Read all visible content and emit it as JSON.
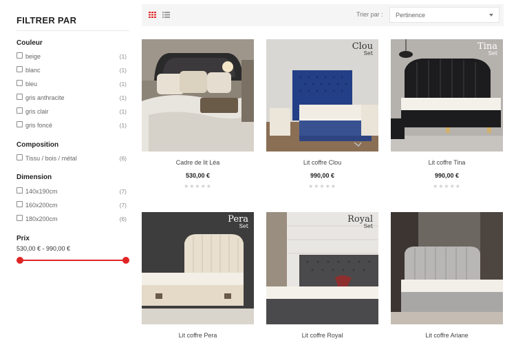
{
  "filters": {
    "title": "FILTRER PAR",
    "groups": [
      {
        "title": "Couleur",
        "options": [
          {
            "label": "beige",
            "count": "(1)"
          },
          {
            "label": "blanc",
            "count": "(1)"
          },
          {
            "label": "bleu",
            "count": "(1)"
          },
          {
            "label": "gris anthracite",
            "count": "(1)"
          },
          {
            "label": "gris clair",
            "count": "(1)"
          },
          {
            "label": "gris foncé",
            "count": "(1)"
          }
        ]
      },
      {
        "title": "Composition",
        "options": [
          {
            "label": "Tissu / bois / métal",
            "count": "(6)"
          }
        ]
      },
      {
        "title": "Dimension",
        "options": [
          {
            "label": "140x190cm",
            "count": "(7)"
          },
          {
            "label": "160x200cm",
            "count": "(7)"
          },
          {
            "label": "180x200cm",
            "count": "(6)"
          }
        ]
      }
    ],
    "price": {
      "title": "Prix",
      "range_text": "530,00 € - 990,00 €",
      "min": 530,
      "max": 990
    }
  },
  "toolbar": {
    "sort_label": "Trier par :",
    "sort_value": "Pertinence"
  },
  "products": [
    {
      "name": "Cadre de lit Léa",
      "price": "530,00 €",
      "stars": "★★★★★",
      "badge_name": "",
      "badge_sub": ""
    },
    {
      "name": "Lit coffre Clou",
      "price": "990,00 €",
      "stars": "★★★★★",
      "badge_name": "Clou",
      "badge_sub": "Set"
    },
    {
      "name": "Lit coffre Tina",
      "price": "990,00 €",
      "stars": "★★★★★",
      "badge_name": "Tina",
      "badge_sub": "Set"
    },
    {
      "name": "Lit coffre Pera",
      "price": "",
      "stars": "",
      "badge_name": "Pera",
      "badge_sub": "Set"
    },
    {
      "name": "Lit coffre Royal",
      "price": "",
      "stars": "",
      "badge_name": "Royal",
      "badge_sub": "Set"
    },
    {
      "name": "Lit coffre Ariane",
      "price": "",
      "stars": "",
      "badge_name": "",
      "badge_sub": ""
    }
  ],
  "colors": {
    "accent": "#e02424",
    "grid_icon_active": "#e02424",
    "list_icon": "#999999"
  },
  "icons": {
    "grid_view": "grid-icon",
    "list_view": "list-icon",
    "sort_caret": "chevron-down-icon"
  }
}
